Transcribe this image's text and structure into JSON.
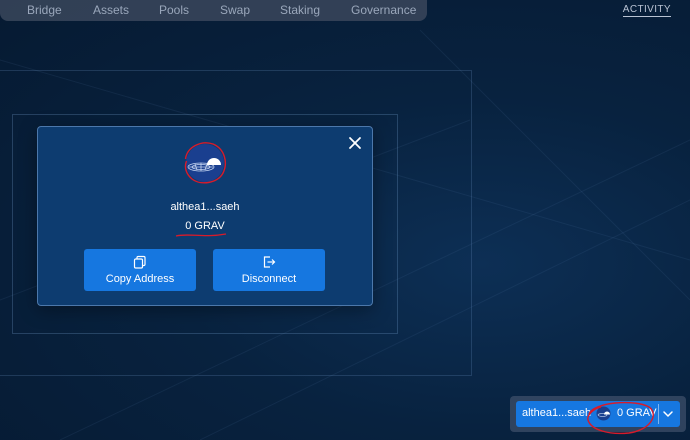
{
  "nav": {
    "items": [
      "Bridge",
      "Assets",
      "Pools",
      "Swap",
      "Staking",
      "Governance"
    ],
    "activity": "ACTIVITY"
  },
  "modal": {
    "address": "althea1...saeh",
    "balance": "0 GRAV",
    "copy_label": "Copy Address",
    "disconnect_label": "Disconnect",
    "icons": {
      "close": "close-icon",
      "avatar": "grav-token-avatar",
      "copy": "copy-icon",
      "disconnect": "logout-icon"
    }
  },
  "wallet": {
    "address": "althea1...saeh",
    "balance": "0 GRAV"
  },
  "colors": {
    "accent": "#1677e0",
    "modal_bg": "#0d3c70",
    "page_bg": "#08223f",
    "annotation": "#d81b2a"
  }
}
